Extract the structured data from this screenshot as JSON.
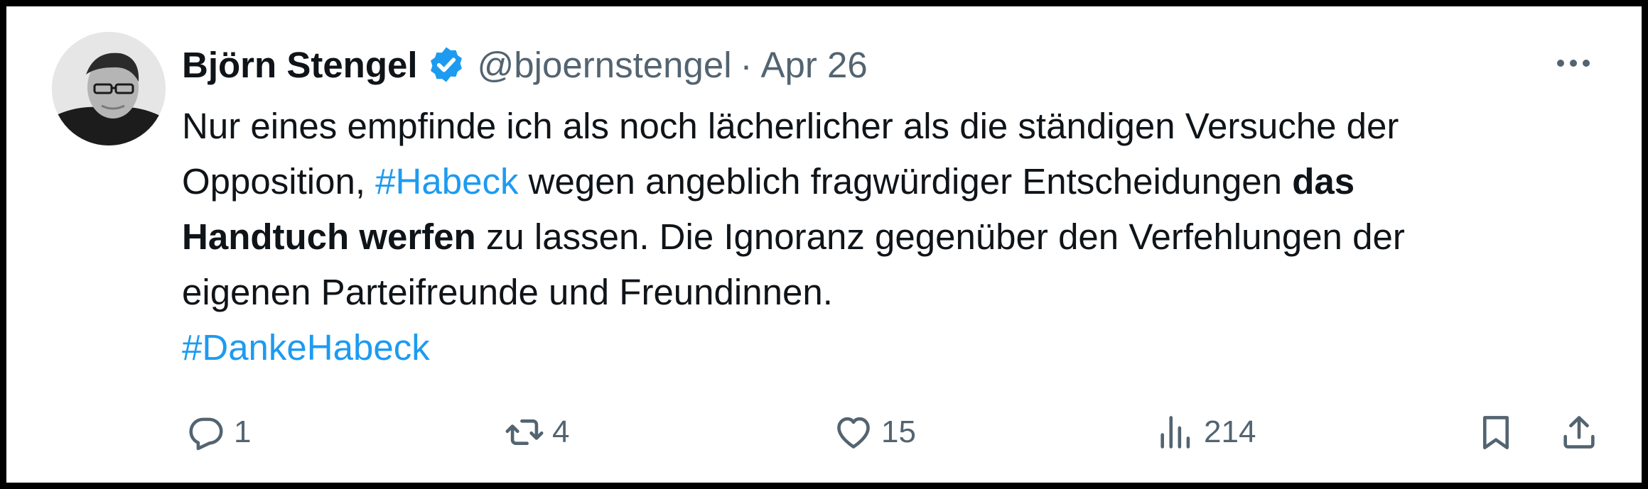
{
  "tweet": {
    "author_name": "Björn Stengel",
    "handle": "@bjoernstengel",
    "separator": "·",
    "date": "Apr 26",
    "verified": true,
    "avatar": "author-portrait",
    "text": {
      "l1": "Nur eines empfinde ich als noch lächerlicher als die ständigen Versuche der",
      "l2_a": "Opposition, ",
      "l2_tag": "#Habeck",
      "l2_b": " wegen angeblich fragwürdiger Entscheidungen ",
      "l2_bold": "das",
      "l3_bold": "Handtuch werfen",
      "l3_b": " zu lassen. Die Ignoranz gegenüber den Verfehlungen der",
      "l4": "eigenen Parteifreunde und Freundinnen.",
      "l5_tag": "#DankeHabeck"
    },
    "stats": {
      "replies": "1",
      "reposts": "4",
      "likes": "15",
      "views": "214"
    }
  },
  "icons": {
    "more": "more-horizontal-icon",
    "reply": "reply-icon",
    "repost": "repost-icon",
    "like": "heart-icon",
    "views": "views-chart-icon",
    "bookmark": "bookmark-icon",
    "share": "share-icon",
    "verified": "verified-badge-icon"
  },
  "colors": {
    "link": "#1d9bf0",
    "text": "#0f1419",
    "secondary": "#536471",
    "frame": "#000000"
  }
}
